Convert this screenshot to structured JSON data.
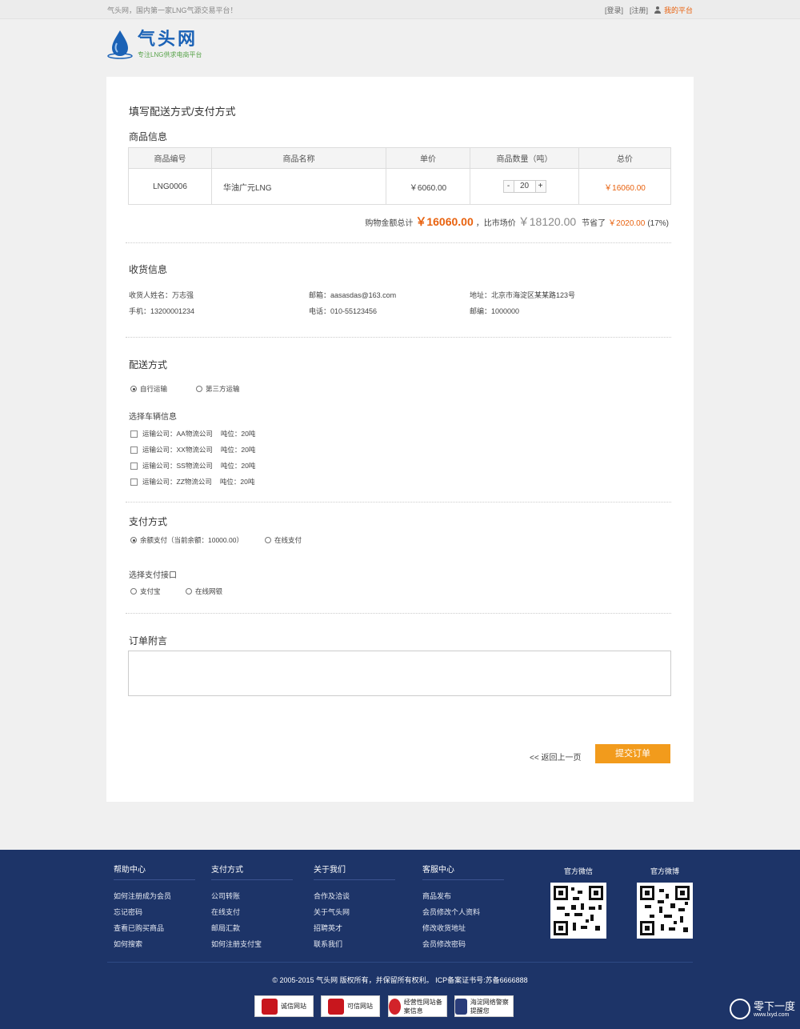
{
  "topbar": {
    "slogan": "气头网，国内第一家LNG气源交易平台！",
    "login": "[登录]",
    "register": "[注册]",
    "my_platform": "我的平台"
  },
  "logo": {
    "name": "气头网",
    "tagline": "专注LNG供求电商平台"
  },
  "page_title": "填写配送方式/支付方式",
  "goods": {
    "title": "商品信息",
    "headers": [
      "商品编号",
      "商品名称",
      "单价",
      "商品数量（吨）",
      "总价"
    ],
    "row": {
      "code": "LNG0006",
      "name": "华油广元LNG",
      "unit_price": "￥6060.00",
      "qty": "20",
      "total": "￥16060.00",
      "minus": "-",
      "plus": "+"
    }
  },
  "summary": {
    "label": "购物金额总计",
    "amount": "￥16060.00",
    "compare_label": "，比市场价",
    "market": "￥18120.00",
    "save_label": "节省了",
    "save_amount": "￥2020.00",
    "save_pct": "(17%)"
  },
  "shipping_info": {
    "title": "收货信息",
    "name": "收货人姓名：万志强",
    "email": "邮箱：aasasdas@163.com",
    "address": "地址：北京市海淀区某某路123号",
    "phone": "手机：13200001234",
    "tel": "电话：010-55123456",
    "zip": "邮编：1000000"
  },
  "delivery": {
    "title": "配送方式",
    "options": [
      "自行运输",
      "第三方运输"
    ],
    "vehicle_title": "选择车辆信息",
    "vehicles": [
      {
        "company": "运输公司：AA物流公司",
        "tons": "吨位：20吨"
      },
      {
        "company": "运输公司：XX物流公司",
        "tons": "吨位：20吨"
      },
      {
        "company": "运输公司：SS物流公司",
        "tons": "吨位：20吨"
      },
      {
        "company": "运输公司：ZZ物流公司",
        "tons": "吨位：20吨"
      }
    ]
  },
  "payment": {
    "title": "支付方式",
    "options": [
      "余额支付（当前余额：10000.00）",
      "在线支付"
    ],
    "gateway_title": "选择支付接口",
    "gateways": [
      "支付宝",
      "在线网银"
    ]
  },
  "note": {
    "title": "订单附言"
  },
  "actions": {
    "back": "<< 返回上一页",
    "submit": "提交订单"
  },
  "footer": {
    "cols": [
      {
        "title": "帮助中心",
        "items": [
          "如何注册成为会员",
          "忘记密码",
          "查看已购买商品",
          "如何搜索"
        ]
      },
      {
        "title": "支付方式",
        "items": [
          "公司转账",
          "在线支付",
          "邮局汇款",
          "如何注册支付宝"
        ]
      },
      {
        "title": "关于我们",
        "items": [
          "合作及洽谈",
          "关于气头网",
          "招聘英才",
          "联系我们"
        ]
      },
      {
        "title": "客服中心",
        "items": [
          "商品发布",
          "会员修改个人资料",
          "修改收货地址",
          "会员修改密码"
        ]
      }
    ],
    "wechat": "官方微信",
    "weibo": "官方微博",
    "copyright": "© 2005-2015 气头网 版权所有，并保留所有权利。  ICP备案证书号:苏备6666888",
    "badges": [
      "诚信网站",
      "可信网站",
      "经营性网站备案信息",
      "海淀网络警察提醒您"
    ]
  },
  "watermark": {
    "name": "零下一度",
    "url": "www.lxyd.com"
  },
  "colors": {
    "accent": "#e8620f",
    "submit": "#f29b1c",
    "footer": "#1d3468",
    "brand": "#1b62b6"
  }
}
